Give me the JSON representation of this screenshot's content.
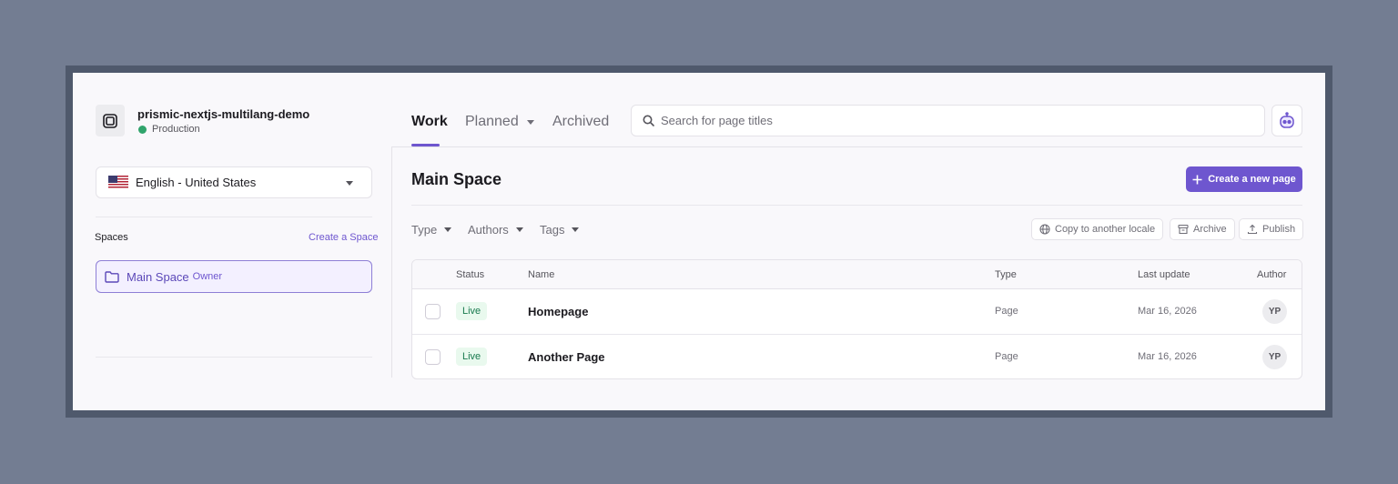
{
  "repository": {
    "name": "prismic-nextjs-multilang-demo",
    "environment": "Production",
    "environment_color": "#30a46c"
  },
  "tabs": [
    {
      "label": "Work",
      "active": true
    },
    {
      "label": "Planned",
      "active": false
    },
    {
      "label": "Archived",
      "active": false
    }
  ],
  "search": {
    "placeholder": "Search for page titles",
    "value": ""
  },
  "sidebar": {
    "locale": {
      "label": "English - United States",
      "flag": "us-flag-icon"
    },
    "spaces_label": "Spaces",
    "create_space": "Create a Space",
    "spaces": [
      {
        "name": "Main Space",
        "role": "Owner",
        "icon": "folder-icon"
      }
    ]
  },
  "main": {
    "title": "Main Space",
    "create_button": "Create a new page",
    "filters": [
      "Type",
      "Authors",
      "Tags"
    ],
    "actions": [
      "Copy to another locale",
      "Archive",
      "Publish"
    ],
    "columns": [
      "Status",
      "Name",
      "Type",
      "Last update",
      "Author"
    ],
    "rows": [
      {
        "status": "Live",
        "name": "Homepage",
        "type": "Page",
        "last_update": "Mar 16, 2026",
        "author": "YP"
      },
      {
        "status": "Live",
        "name": "Another Page",
        "type": "Page",
        "last_update": "Mar 16, 2026",
        "author": "YP"
      }
    ]
  },
  "colors": {
    "accent": "#6e56cf",
    "live_badge_bg": "#e9f9ee",
    "live_badge_text": "#18794e"
  }
}
